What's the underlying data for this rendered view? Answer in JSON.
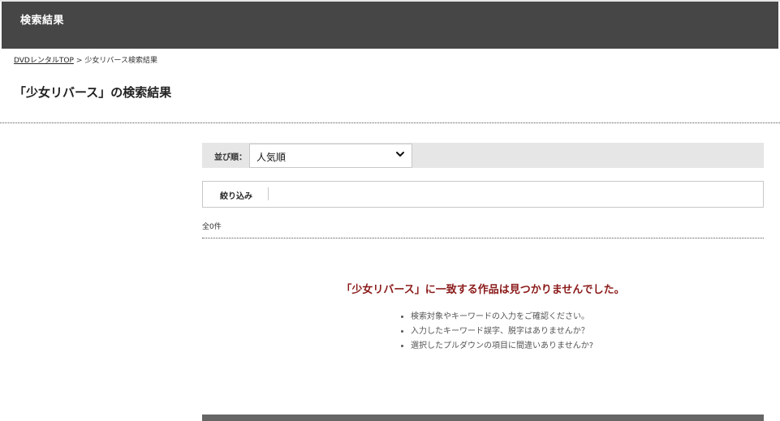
{
  "header": {
    "title": "検索結果"
  },
  "breadcrumb": {
    "home_link": "DVDレンタルTOP",
    "separator": ">",
    "current": "少女リバース検索結果"
  },
  "page": {
    "title": "「少女リバース」の検索結果"
  },
  "sort": {
    "label": "並び順：",
    "selected": "人気順",
    "icon": "chevron-down-icon"
  },
  "filter": {
    "label": "絞り込み"
  },
  "results": {
    "count_text": "全0件"
  },
  "no_result": {
    "message": "「少女リバース」に一致する作品は見つかりませんでした。",
    "tips": [
      "検索対象やキーワードの入力をご確認ください。",
      "入力したキーワード誤字、脱字はありませんか？",
      "選択したプルダウンの項目に間違いありませんか?"
    ]
  },
  "colors": {
    "header_bg": "#464646",
    "sort_bar_bg": "#e6e6e6",
    "message_red": "#8b1a1a"
  }
}
